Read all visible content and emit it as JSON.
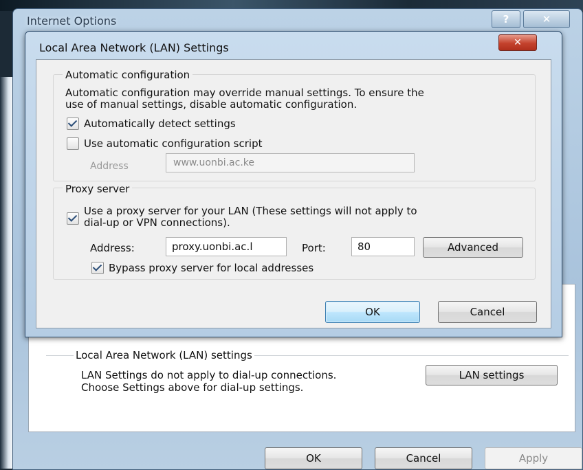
{
  "internet_options": {
    "title": "Internet Options",
    "help_button": "?",
    "close_button": "✕",
    "lan_group": {
      "legend": "Local Area Network (LAN) settings",
      "description_line1": "LAN Settings do not apply to dial-up connections.",
      "description_line2": "Choose Settings above for dial-up settings.",
      "button": "LAN settings"
    },
    "buttons": {
      "ok": "OK",
      "cancel": "Cancel",
      "apply": "Apply"
    }
  },
  "lan_dialog": {
    "title": "Local Area Network (LAN) Settings",
    "close_button": "✕",
    "automatic_configuration": {
      "legend": "Automatic configuration",
      "description_line1": "Automatic configuration may override manual settings.  To ensure the",
      "description_line2": "use of manual settings, disable automatic configuration.",
      "auto_detect": {
        "label": "Automatically detect settings",
        "checked": true
      },
      "use_script": {
        "label": "Use automatic configuration script",
        "checked": false
      },
      "address_label": "Address",
      "address_value": "www.uonbi.ac.ke"
    },
    "proxy_server": {
      "legend": "Proxy server",
      "use_proxy": {
        "line1": "Use a proxy server for your LAN (These settings will not apply to",
        "line2": "dial-up or VPN connections).",
        "checked": true
      },
      "address_label": "Address:",
      "address_value": "proxy.uonbi.ac.l",
      "port_label": "Port:",
      "port_value": "80",
      "advanced_button": "Advanced",
      "bypass": {
        "label": "Bypass proxy server for local addresses",
        "checked": true
      }
    },
    "buttons": {
      "ok": "OK",
      "cancel": "Cancel"
    }
  }
}
